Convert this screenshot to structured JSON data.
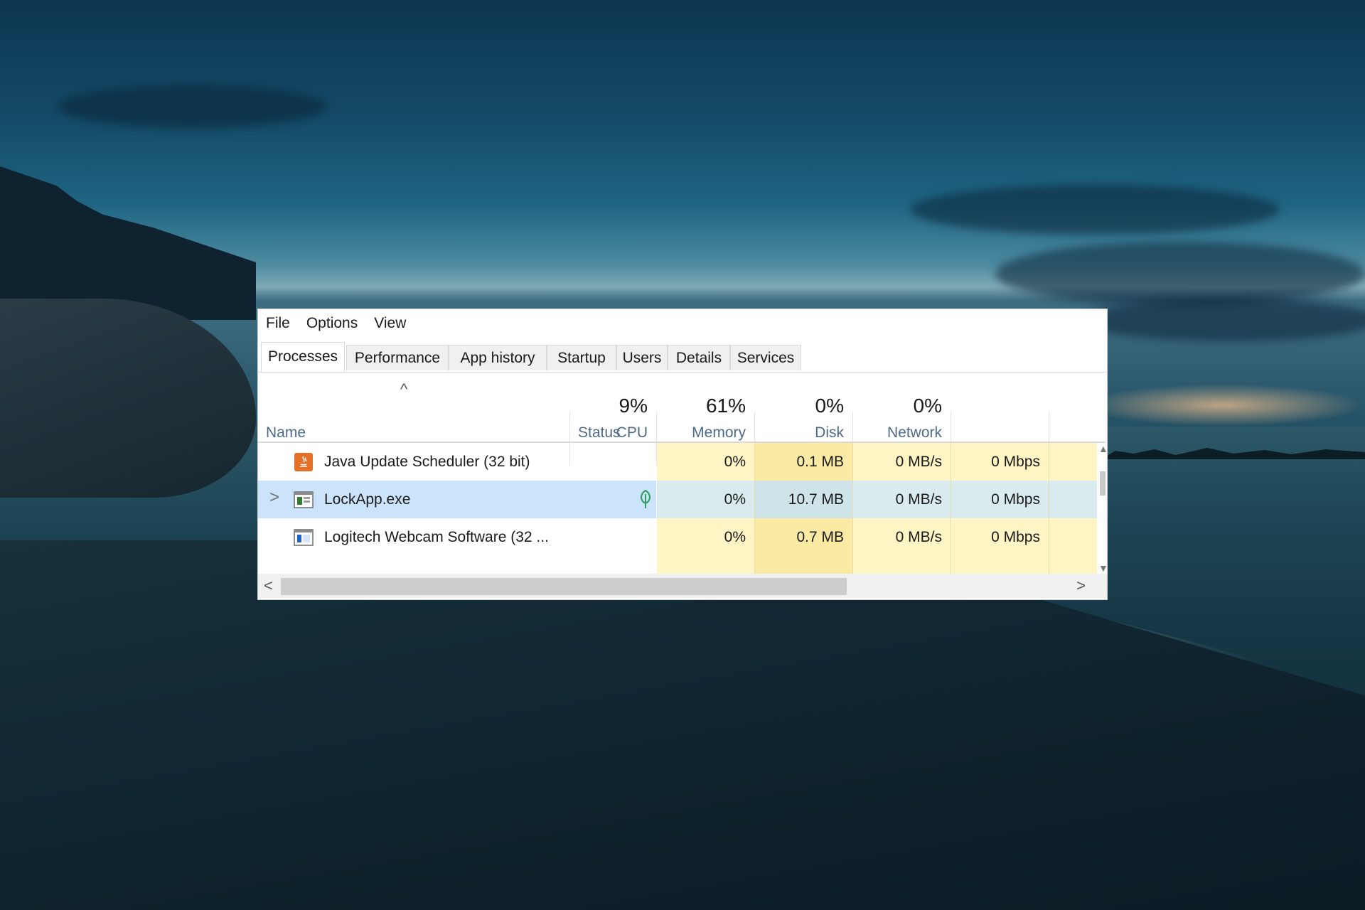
{
  "menu": [
    "File",
    "Options",
    "View"
  ],
  "tabs": [
    "Processes",
    "Performance",
    "App history",
    "Startup",
    "Users",
    "Details",
    "Services"
  ],
  "active_tab": "Processes",
  "columns": {
    "name": "Name",
    "status": "Status",
    "cpu": {
      "pct": "9%",
      "label": "CPU"
    },
    "memory": {
      "pct": "61%",
      "label": "Memory"
    },
    "disk": {
      "pct": "0%",
      "label": "Disk"
    },
    "network": {
      "pct": "0%",
      "label": "Network"
    }
  },
  "sort_indicator": "^",
  "processes": [
    {
      "name": "Java Update Scheduler (32 bit)",
      "cpu": "0%",
      "memory": "0.1 MB",
      "disk": "0 MB/s",
      "network": "0 Mbps",
      "icon": "java-icon"
    },
    {
      "name": "LockApp.exe",
      "cpu": "0%",
      "memory": "10.7 MB",
      "disk": "0 MB/s",
      "network": "0 Mbps",
      "icon": "app-window-icon",
      "expand": ">",
      "selected": true,
      "status_icon": "leaf-icon"
    },
    {
      "name": "Logitech Webcam Software (32 ...",
      "cpu": "0%",
      "memory": "0.7 MB",
      "disk": "0 MB/s",
      "network": "0 Mbps",
      "icon": "webcam-app-icon"
    }
  ],
  "scroll": {
    "left": "<",
    "right": ">"
  },
  "colors": {
    "cpu_cell": "#fff4c4",
    "memory_cell": "#fbeaa4",
    "selected_row": "#cce4fb",
    "header_label": "#4d6a8a"
  }
}
